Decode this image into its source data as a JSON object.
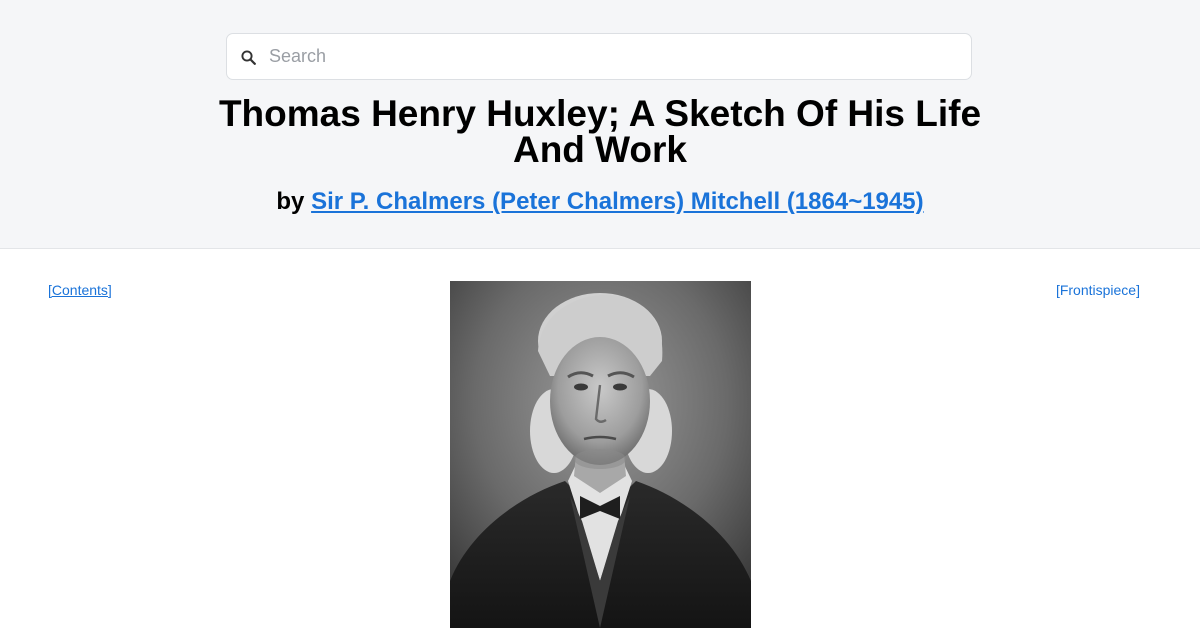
{
  "search": {
    "placeholder": "Search",
    "value": ""
  },
  "book": {
    "title": "Thomas Henry Huxley; A Sketch Of His Life And Work",
    "by_prefix": "by",
    "author": "Sir P. Chalmers (Peter Chalmers) Mitchell (1864~1945)"
  },
  "nav": {
    "contents_label": "[Contents]",
    "frontispiece_label": "[Frontispiece]"
  },
  "image": {
    "alt": "Portrait of Thomas Henry Huxley"
  },
  "colors": {
    "header_bg": "#f5f6f8",
    "link": "#1a73d9",
    "text": "#000000"
  },
  "icons": {
    "search": "search-icon"
  }
}
